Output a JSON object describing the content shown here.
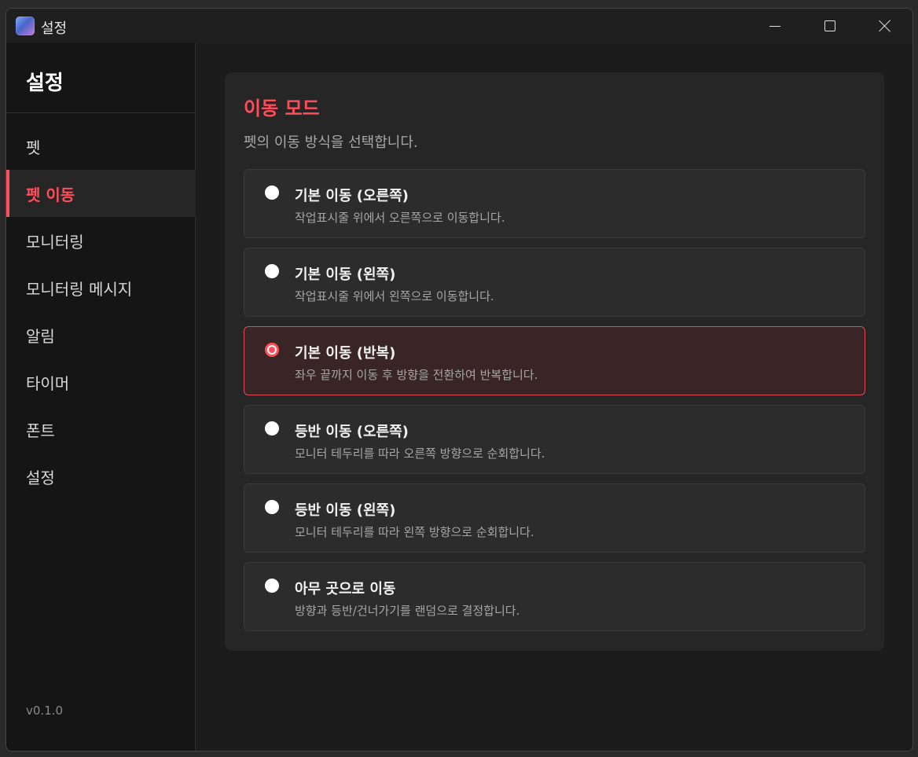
{
  "window": {
    "title": "설정"
  },
  "sidebar": {
    "title": "설정",
    "items": [
      {
        "label": "펫",
        "active": false
      },
      {
        "label": "펫 이동",
        "active": true
      },
      {
        "label": "모니터링",
        "active": false
      },
      {
        "label": "모니터링 메시지",
        "active": false
      },
      {
        "label": "알림",
        "active": false
      },
      {
        "label": "타이머",
        "active": false
      },
      {
        "label": "폰트",
        "active": false
      },
      {
        "label": "설정",
        "active": false
      }
    ],
    "version": "v0.1.0"
  },
  "main": {
    "section_title": "이동 모드",
    "section_desc": "펫의 이동 방식을 선택합니다.",
    "options": [
      {
        "label": "기본 이동 (오른쪽)",
        "desc": "작업표시줄 위에서 오른쪽으로 이동합니다.",
        "selected": false
      },
      {
        "label": "기본 이동 (왼쪽)",
        "desc": "작업표시줄 위에서 왼쪽으로 이동합니다.",
        "selected": false
      },
      {
        "label": "기본 이동 (반복)",
        "desc": "좌우 끝까지 이동 후 방향을 전환하여 반복합니다.",
        "selected": true
      },
      {
        "label": "등반 이동 (오른쪽)",
        "desc": "모니터 테두리를 따라 오른쪽 방향으로 순회합니다.",
        "selected": false
      },
      {
        "label": "등반 이동 (왼쪽)",
        "desc": "모니터 테두리를 따라 왼쪽 방향으로 순회합니다.",
        "selected": false
      },
      {
        "label": "아무 곳으로 이동",
        "desc": "방향과 등반/건너가기를 랜덤으로 결정합니다.",
        "selected": false
      }
    ]
  },
  "colors": {
    "accent": "#ff4d5a",
    "selected_bg": "#3a2526",
    "card_bg": "#262626",
    "sidebar_bg": "#151515"
  }
}
